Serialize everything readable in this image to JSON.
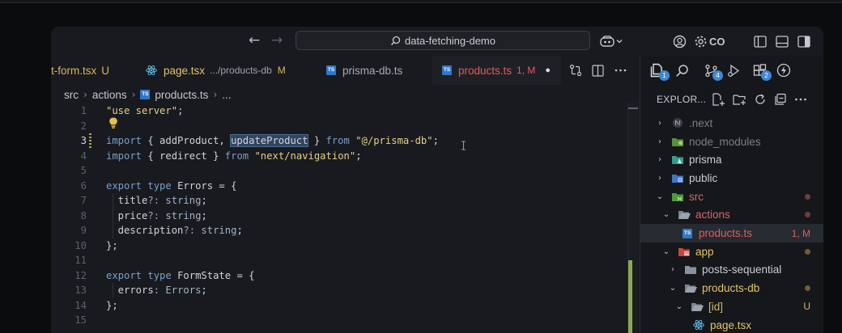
{
  "titlebar": {
    "search_text": "data-fetching-demo",
    "account_text": "CO",
    "back_arrow": "←",
    "forward_arrow": "→"
  },
  "tabs": [
    {
      "label": "t-form.tsx",
      "status": "U",
      "color": "#d7b661",
      "status_color": "#d7b661"
    },
    {
      "label": "page.tsx",
      "path": ".../products-db",
      "status": "M",
      "color": "#e3c468",
      "status_color": "#d7b661"
    },
    {
      "label": "prisma-db.ts",
      "color": "#a7abb3"
    },
    {
      "label": "products.ts",
      "status": "1, M",
      "color": "#e05d5d",
      "status_color": "#e05d5d",
      "modified_dot": "●"
    }
  ],
  "breadcrumb": {
    "items": [
      "src",
      "actions",
      "products.ts",
      "..."
    ]
  },
  "editor": {
    "line_numbers": [
      "1",
      "2",
      "3",
      "4",
      "5",
      "6",
      "7",
      "8",
      "9",
      "10",
      "11",
      "12",
      "13",
      "14",
      "15"
    ],
    "current_line": "3"
  },
  "code": {
    "l1": {
      "str": "\"use server\"",
      "rest": ";"
    },
    "l3": {
      "kw1": "import",
      "p1": " { addProduct, ",
      "sel": "updateProduct",
      "p2": " } ",
      "kw2": "from",
      "sp": " ",
      "str": "\"@/prisma-db\"",
      "rest": ";"
    },
    "l4": {
      "kw1": "import",
      "p1": " { redirect } ",
      "kw2": "from",
      "sp": " ",
      "str": "\"next/navigation\"",
      "rest": ";"
    },
    "l6": {
      "kw1": "export",
      "sp1": " ",
      "kw2": "type",
      "p1": " Errors = {"
    },
    "l7": {
      "p1": "  title",
      "op": "?:",
      "sp": " ",
      "ty": "string",
      "rest": ";"
    },
    "l8": {
      "p1": "  price",
      "op": "?:",
      "sp": " ",
      "ty": "string",
      "rest": ";"
    },
    "l9": {
      "p1": "  description",
      "op": "?:",
      "sp": " ",
      "ty": "string",
      "rest": ";"
    },
    "l10": {
      "p1": "};"
    },
    "l12": {
      "kw1": "export",
      "sp1": " ",
      "kw2": "type",
      "p1": " FormState = {"
    },
    "l13": {
      "p1": "  errors",
      "op": ":",
      "sp": " ",
      "ty": "Errors",
      "rest": ";"
    },
    "l14": {
      "p1": "};"
    }
  },
  "activity": {
    "badges": [
      "1",
      "4",
      "2"
    ]
  },
  "explorer": {
    "title": "EXPLOR...",
    "items": [
      {
        "label": ".next",
        "color": "#7b7f87",
        "chev": "›"
      },
      {
        "label": "node_modules",
        "color": "#7b7f87",
        "chev": "›"
      },
      {
        "label": "prisma",
        "color": "#c9ccd2",
        "chev": "›"
      },
      {
        "label": "public",
        "color": "#c9ccd2",
        "chev": "›"
      },
      {
        "label": "src",
        "color": "#d9676a",
        "chev": "⌄"
      },
      {
        "label": "actions",
        "color": "#d9676a",
        "chev": "⌄"
      },
      {
        "label": "products.ts",
        "color": "#e05d5d",
        "badge": "1, M"
      },
      {
        "label": "app",
        "color": "#e3c468",
        "chev": "⌄"
      },
      {
        "label": "posts-sequential",
        "color": "#c9ccd2",
        "chev": "›"
      },
      {
        "label": "products-db",
        "color": "#e3c468",
        "chev": "⌄"
      },
      {
        "label": "[id]",
        "color": "#d7b661",
        "chev": "⌄",
        "badge": "U"
      },
      {
        "label": "page.tsx",
        "color": "#e3c468"
      }
    ]
  },
  "colors": {
    "ts_blue": "#3178c6",
    "error_red": "#e05d5d",
    "modified_yellow": "#d7b661",
    "accent_blue": "#3e88d6"
  }
}
